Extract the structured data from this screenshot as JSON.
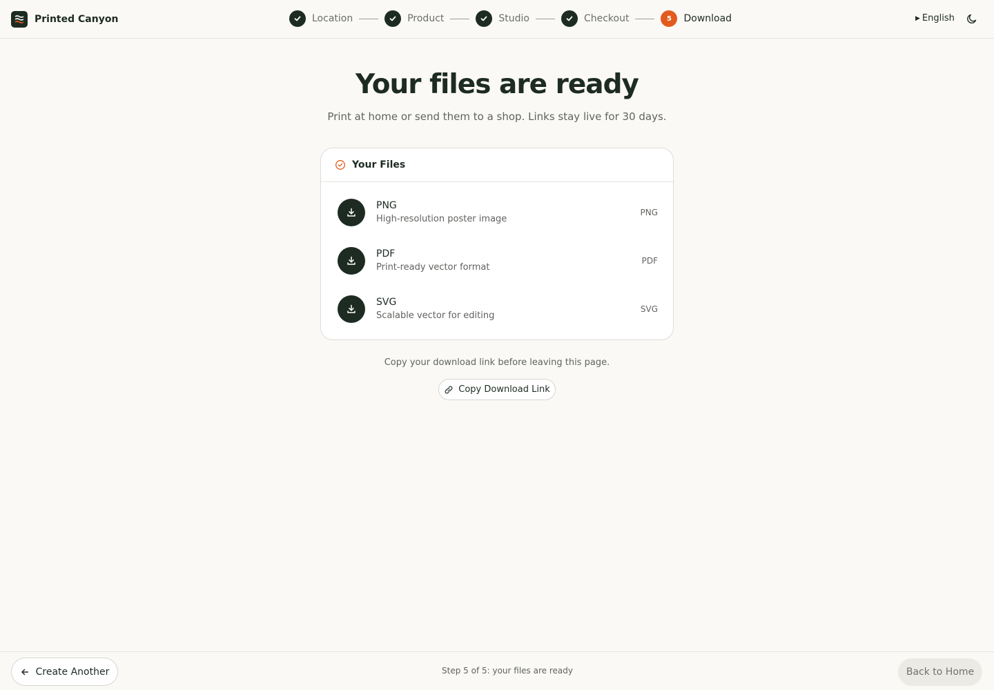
{
  "app": {
    "name": "Printed Canyon"
  },
  "steps": [
    {
      "label": "Location",
      "state": "done"
    },
    {
      "label": "Product",
      "state": "done"
    },
    {
      "label": "Studio",
      "state": "done"
    },
    {
      "label": "Checkout",
      "state": "done"
    },
    {
      "label": "Download",
      "state": "active",
      "number": "5"
    }
  ],
  "header": {
    "language": "English",
    "theme_icon": "moon-icon"
  },
  "hero": {
    "title": "Your files are ready",
    "subtitle": "Print at home or send them to a shop. Links stay live for 30 days."
  },
  "files_card": {
    "title": "Your Files",
    "files": [
      {
        "name": "PNG",
        "description": "High-resolution poster image",
        "format": "PNG"
      },
      {
        "name": "PDF",
        "description": "Print-ready vector format",
        "format": "PDF"
      },
      {
        "name": "SVG",
        "description": "Scalable vector for editing",
        "format": "SVG"
      }
    ]
  },
  "copy": {
    "hint": "Copy your download link before leaving this page.",
    "button": "Copy Download Link"
  },
  "footer": {
    "create_another": "Create Another",
    "status": "Step 5 of 5: your files are ready",
    "back_home": "Back to Home"
  },
  "colors": {
    "accent": "#e35a1e",
    "primary": "#1d2b22",
    "background": "#faf9f6"
  }
}
